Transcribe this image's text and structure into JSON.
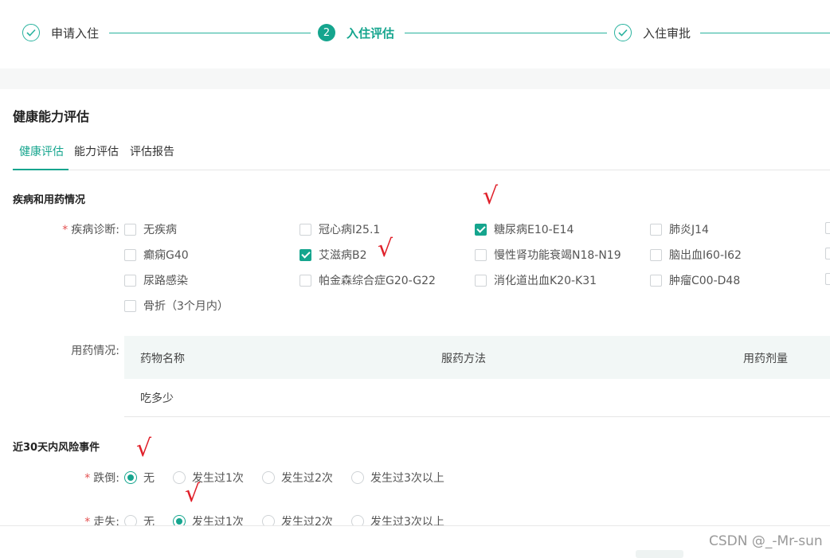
{
  "steps": [
    {
      "label": "申请入住",
      "state": "done",
      "icon": "check-circle-icon"
    },
    {
      "label": "入住评估",
      "state": "active",
      "number": "2"
    },
    {
      "label": "入住审批",
      "state": "done",
      "icon": "check-circle-icon"
    }
  ],
  "section_title": "健康能力评估",
  "tabs": [
    "健康评估",
    "能力评估",
    "评估报告"
  ],
  "disease_section": {
    "title": "疾病和用药情况",
    "diagnosis_label": "疾病诊断:",
    "options": [
      {
        "label": "无疾病",
        "checked": false
      },
      {
        "label": "冠心病I25.1",
        "checked": false
      },
      {
        "label": "糖尿病E10-E14",
        "checked": true
      },
      {
        "label": "肺炎J14",
        "checked": false
      },
      {
        "label": "癫痫G40",
        "checked": false
      },
      {
        "label": "艾滋病B2",
        "checked": true
      },
      {
        "label": "慢性肾功能衰竭N18-N19",
        "checked": false
      },
      {
        "label": "脑出血I60-I62",
        "checked": false
      },
      {
        "label": "尿路感染",
        "checked": false
      },
      {
        "label": "帕金森综合症G20-G22",
        "checked": false
      },
      {
        "label": "消化道出血K20-K31",
        "checked": false
      },
      {
        "label": "肿瘤C00-D48",
        "checked": false
      },
      {
        "label": "骨折（3个月内）",
        "checked": false
      }
    ],
    "medication_label": "用药情况:",
    "table": {
      "headers": [
        "药物名称",
        "服药方法",
        "用药剂量"
      ],
      "rows": [
        [
          "吃多少",
          "",
          ""
        ]
      ]
    }
  },
  "risk_section": {
    "title": "近30天内风险事件",
    "fall": {
      "label": "跌倒:",
      "options": [
        "无",
        "发生过1次",
        "发生过2次",
        "发生过3次以上"
      ],
      "selected": "无"
    },
    "lost": {
      "label": "走失:",
      "options": [
        "无",
        "发生过1次",
        "发生过2次",
        "发生过3次以上"
      ],
      "selected": "发生过1次"
    }
  },
  "annotation_mark": "√",
  "watermark": "CSDN @_-Mr-sun",
  "colors": {
    "accent": "#15a58e",
    "required": "#e35050",
    "annotation": "#e0202a"
  }
}
